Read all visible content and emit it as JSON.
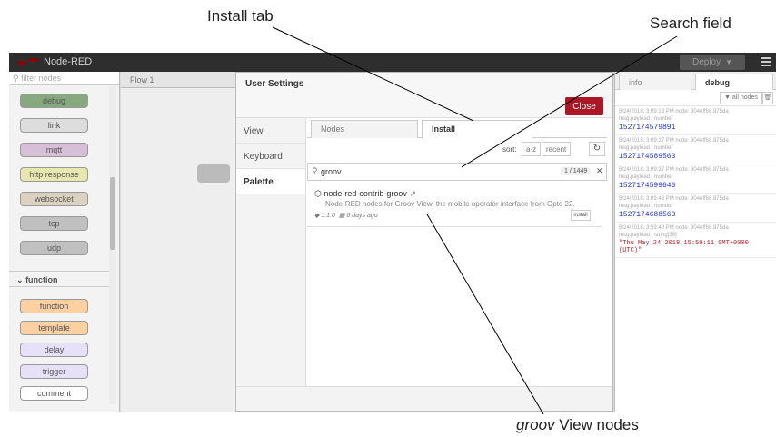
{
  "annotations": {
    "install_tab": "Install tab",
    "search_field": "Search field",
    "view_nodes_em": "groov",
    "view_nodes_rest": " View nodes"
  },
  "app": {
    "title": "Node-RED",
    "deploy_label": "Deploy"
  },
  "palette": {
    "filter_placeholder": "filter nodes",
    "nodes_top": [
      "debug",
      "link",
      "mqtt",
      "http response",
      "websocket",
      "tcp",
      "udp"
    ],
    "category": "function",
    "nodes_function": [
      "function",
      "template",
      "delay",
      "trigger",
      "comment"
    ]
  },
  "workspace": {
    "tab": "Flow 1"
  },
  "dialog": {
    "title": "User Settings",
    "close_label": "Close",
    "sections": [
      "View",
      "Keyboard",
      "Palette"
    ],
    "tabs": [
      "Nodes",
      "Install"
    ],
    "sort_label": "sort:",
    "sort_options": [
      "a-z",
      "recent"
    ],
    "search_value": "groov",
    "search_count": "1 / 1449",
    "result": {
      "name": "node-red-contrib-groov",
      "description": "Node-RED nodes for Groov View, the mobile operator interface from Opto 22.",
      "version": "1.1.0",
      "updated": "6 days ago",
      "install_label": "install"
    }
  },
  "sidebar": {
    "tabs": [
      "info",
      "debug"
    ],
    "all_nodes_label": "all nodes",
    "messages": [
      {
        "meta": "5/24/2018, 3:09:18 PM   node: 904eff68.875da",
        "topic": "msg.payload : number",
        "value": "1527174579891"
      },
      {
        "meta": "5/24/2018, 3:09:27 PM   node: 904eff68.875da",
        "topic": "msg.payload : number",
        "value": "1527174589563"
      },
      {
        "meta": "5/24/2018, 3:09:37 PM   node: 904eff68.875da",
        "topic": "msg.payload : number",
        "value": "1527174599646"
      },
      {
        "meta": "5/24/2018, 3:09:48 PM   node: 904eff68.875da",
        "topic": "msg.payload : number",
        "value": "1527174688563"
      },
      {
        "meta": "5/24/2018, 3:59:48 PM   node: 904eff68.875da",
        "topic": "msg.payload : string[39]",
        "value": "\"Thu May 24 2018 15:59:11 GMT+0000 (UTC)\""
      }
    ]
  },
  "colors": {
    "close_button": "#ad1625",
    "topbar": "#2e2e2e",
    "number_value": "#2033d6",
    "string_value": "#b72828"
  }
}
